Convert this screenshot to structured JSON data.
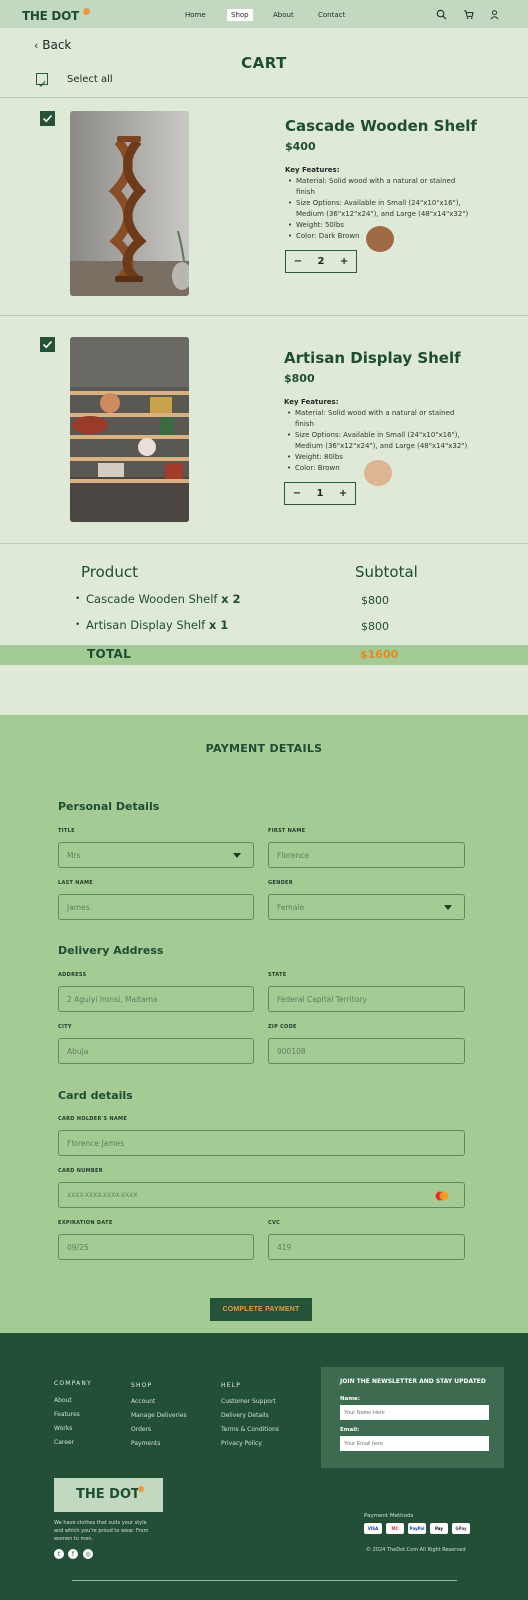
{
  "nav": {
    "logo": "THE DOT",
    "links": [
      "Home",
      "Shop",
      "About",
      "Contact"
    ],
    "active": "Shop",
    "icons": [
      "search-icon",
      "cart-icon",
      "user-icon"
    ]
  },
  "cart": {
    "back_label": "Back",
    "title": "CART",
    "select_all": "Select all"
  },
  "products": [
    {
      "title": "Cascade  Wooden Shelf",
      "price": "$400",
      "features_title": "Key Features:",
      "features": [
        "Material: Solid wood with a natural or stained finish",
        "Size Options: Available in Small (24\"x10\"x16\"), Medium (36\"x12\"x24\"), and Large (48\"x14\"x32\")",
        "Weight: 50lbs",
        "Color: Dark Brown"
      ],
      "qty": "2",
      "swatch": "#a06a45"
    },
    {
      "title": "Artisan Display Shelf",
      "price": "$800",
      "features_title": "Key Features:",
      "features": [
        "Material: Solid wood with a natural or stained finish",
        "Size Options: Available in Small (24\"x10\"x16\"), Medium (36\"x12\"x24\"), and Large (48\"x14\"x32\")",
        "Weight: 80lbs",
        "Color: Brown"
      ],
      "qty": "1",
      "swatch": "#dcb592"
    }
  ],
  "summary": {
    "col_product": "Product",
    "col_subtotal": "Subtotal",
    "items": [
      {
        "name": "Cascade  Wooden Shelf ",
        "mult": "x 2",
        "value": "$800"
      },
      {
        "name": "Artisan Display Shelf ",
        "mult": "x 1",
        "value": "$800"
      }
    ],
    "total_label": "TOTAL",
    "total_value": "$1600"
  },
  "payment": {
    "title": "PAYMENT DETAILS",
    "personal_title": "Personal Details",
    "delivery_title": "Delivery Address",
    "card_title": "Card details",
    "fields": {
      "title": {
        "label": "TITLE",
        "value": "Mrs"
      },
      "first_name": {
        "label": "FIRST NAME",
        "value": "Florence"
      },
      "last_name": {
        "label": "LAST NAME",
        "value": "James"
      },
      "gender": {
        "label": "GENDER",
        "value": "Female"
      },
      "address": {
        "label": "ADDRESS",
        "value": "2 Aguiyi Ironsi, Maitama"
      },
      "state": {
        "label": "STATE",
        "value": "Federal Capital Territory"
      },
      "city": {
        "label": "CITY",
        "value": "Abuja"
      },
      "zip": {
        "label": "ZIP CODE",
        "value": "900108"
      },
      "holder": {
        "label": "CARD HOLDER'S NAME",
        "value": "Florence James"
      },
      "number": {
        "label": "CARD NUMBER",
        "value": "XXXX-XXXX-XXXX-XXXX"
      },
      "expiry": {
        "label": "EXPIRATION DATE",
        "value": "09/25"
      },
      "cvc": {
        "label": "CVC",
        "value": "419"
      }
    },
    "button": "COMPLETE PAYMENT"
  },
  "footer": {
    "company_title": "COMPANY",
    "company_items": [
      "About",
      "Features",
      "Works",
      "Career"
    ],
    "shop_title": "SHOP",
    "shop_items": [
      "Account",
      "Manage Deliveries",
      "Orders",
      "Payments"
    ],
    "help_title": "HELP",
    "help_items": [
      "Customer Support",
      "Delivery Details",
      "Terms & Conditions",
      "Privacy Policy"
    ],
    "newsletter_title": "JOIN THE NEWSLETTER AND STAY UPDATED",
    "name_label": "Name:",
    "name_placeholder": "Your Name Here",
    "email_label": "Email:",
    "email_placeholder": "Your Email here",
    "logo": "THE DOT",
    "tagline": "We have clothes that suits your style and which you're proud to wear. From women to men.",
    "payment_title": "Payment Methods",
    "payment_methods": [
      "VISA",
      "MC",
      "PayPal",
      "Pay",
      "GPay"
    ],
    "copyright": "© 2024 TheDot.Com All Right Reserved",
    "colors": {
      "accent": "#e89a3c",
      "dark": "#244f37",
      "brand": "#1e4d34"
    }
  }
}
